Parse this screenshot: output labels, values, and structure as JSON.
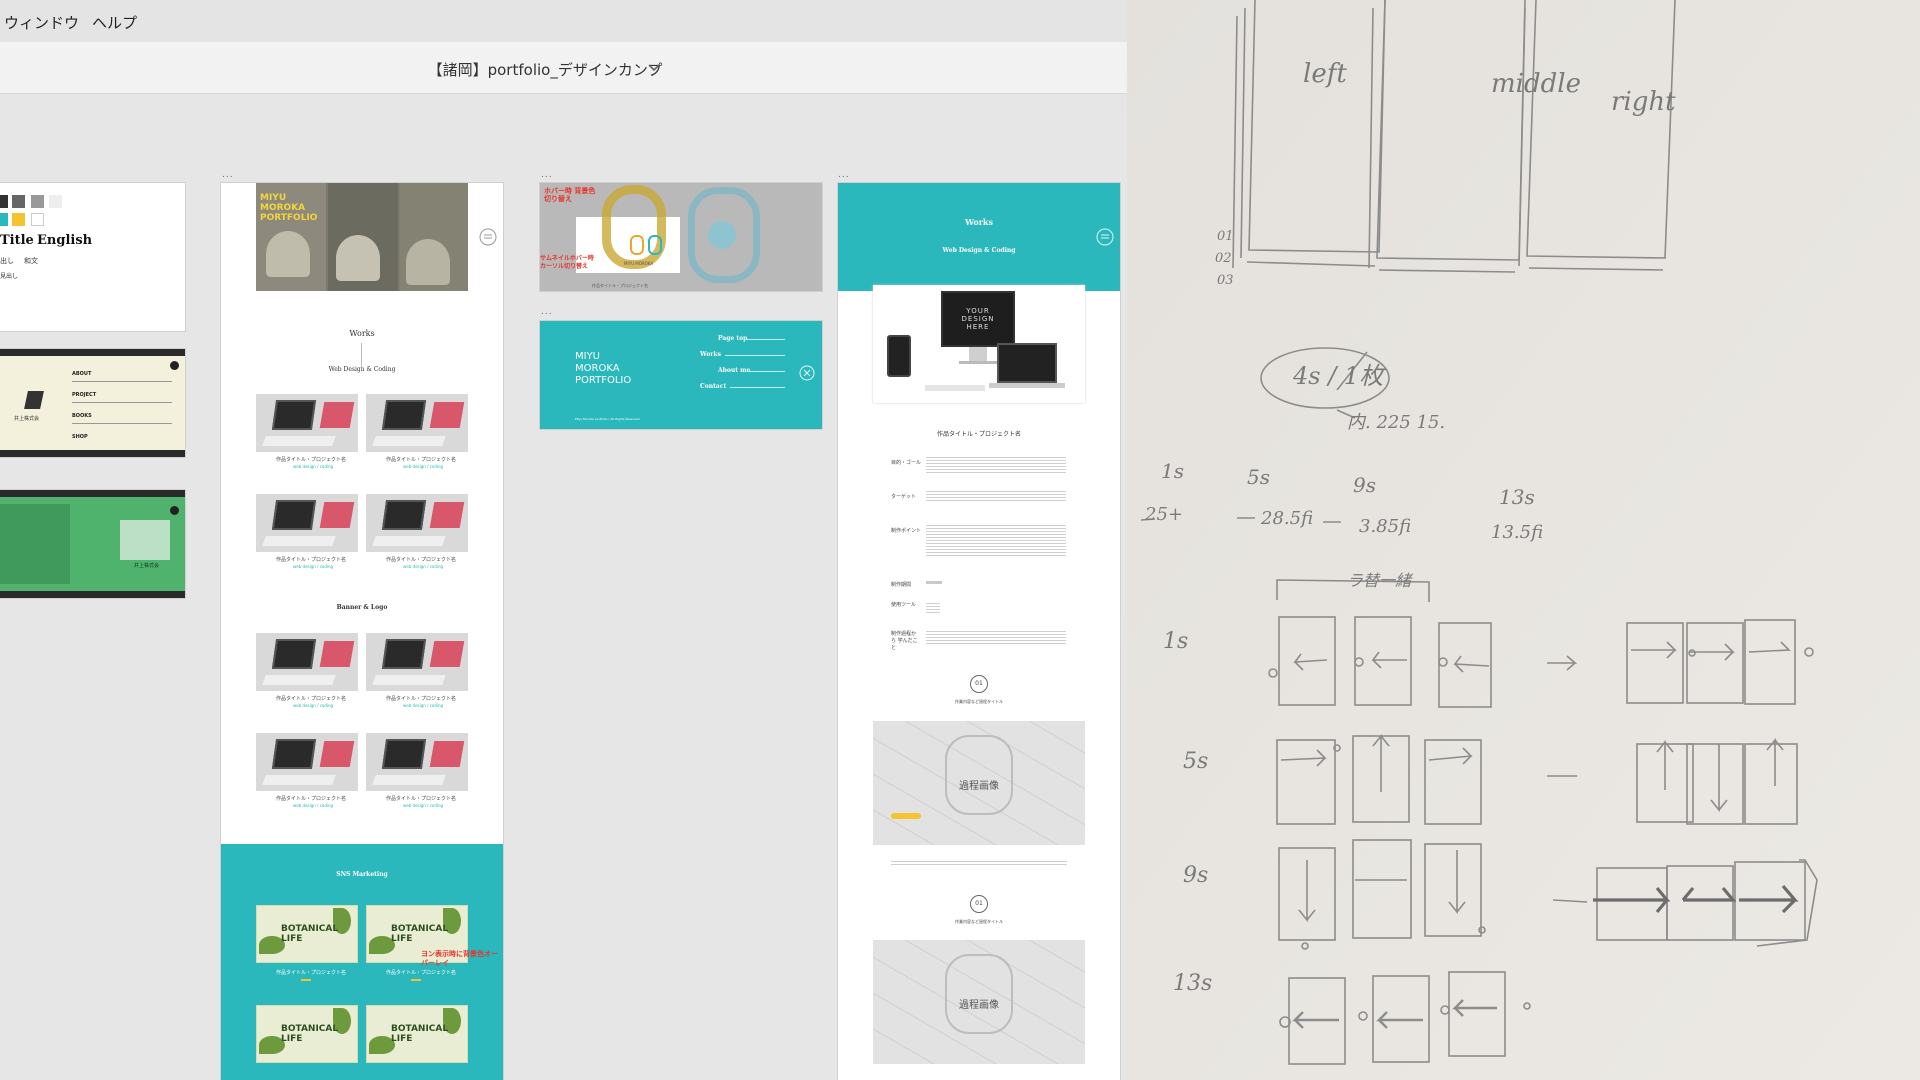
{
  "menu": {
    "items": [
      {
        "label": "ウィンドウ"
      },
      {
        "label": "ヘルプ"
      }
    ]
  },
  "document": {
    "title": "【諸岡】portfolio_デザインカンプ"
  },
  "artboards": {
    "handle": "...",
    "style_guide": {
      "title_label": "Title",
      "english_label": "English",
      "heading_label": "出し",
      "body_label": "和文",
      "sub_label": "見出し",
      "swatches": [
        "#333333",
        "#666666",
        "#999999",
        "#eeeeee",
        "#2bb8bc",
        "#f4c430",
        "#ffffff"
      ]
    },
    "thumb_1": {
      "menu_items": [
        "ABOUT",
        "PROJECT",
        "BOOKS",
        "SHOP"
      ],
      "logo_text": "井上株式会"
    },
    "thumb_2": {
      "logo_text": "井上株式会"
    },
    "top_page": {
      "hero_text": "MIYU MOROKA PORTFOLIO",
      "section_works": "Works",
      "section_sub": "Web Design & Coding",
      "section_banner": "Banner & Logo",
      "card_caption": "作品タイトル・プロジェクト名",
      "card_sub": "web design / coding",
      "sns_title": "SNS Marketing",
      "sns_card_title": "BOTANICAL LIFE",
      "sns_caption": "作品タイトル・プロジェクト名",
      "annotation": "ヨン表示時に背景色オーバーレイ"
    },
    "hover_board": {
      "note_top": "ホバー時 背景色切り替え",
      "note_left": "サムネイルホバー時 カーソル切り替え",
      "logo_caption": "MIYU MOROKA",
      "caption": "作品タイトル・プロジェクト名"
    },
    "menu_board": {
      "logo_lines": [
        "MIYU",
        "MOROKA",
        "PORTFOLIO"
      ],
      "nav": [
        "Page top",
        "Works",
        "About me",
        "Contact"
      ],
      "footer": "Miyu Moroka portfolio / All Rights Reserved"
    },
    "detail_page": {
      "header_title": "Works",
      "header_sub": "Web Design & Coding",
      "mock_text": "YOUR DESIGN HERE",
      "project_title": "作品タイトル・プロジェクト名",
      "rows": [
        "目的・ゴール",
        "ターゲット",
        "制作ポイント",
        "制作期間",
        "使用ツール",
        "制作過程から 学んだこと"
      ],
      "process_title": "作業内容など過程タイトル",
      "process_image_label": "過程画像",
      "process_icon": "01"
    }
  },
  "sketch": {
    "panel_labels": [
      "left",
      "middle",
      "right"
    ],
    "page_numbers": [
      "01",
      "02",
      "03"
    ],
    "loop_note": "4s / 1枚",
    "loop_note_sub": "内. 225 15.",
    "timeline_top": [
      "1s",
      "5s",
      "9s",
      "13s"
    ],
    "timeline_bottom": [
      "25+",
      "28.5fi",
      "3.85fi",
      "13.5fi"
    ],
    "row_labels": [
      "1s",
      "5s",
      "9s",
      "13s"
    ],
    "bracket_note": "ラ替一緒"
  }
}
